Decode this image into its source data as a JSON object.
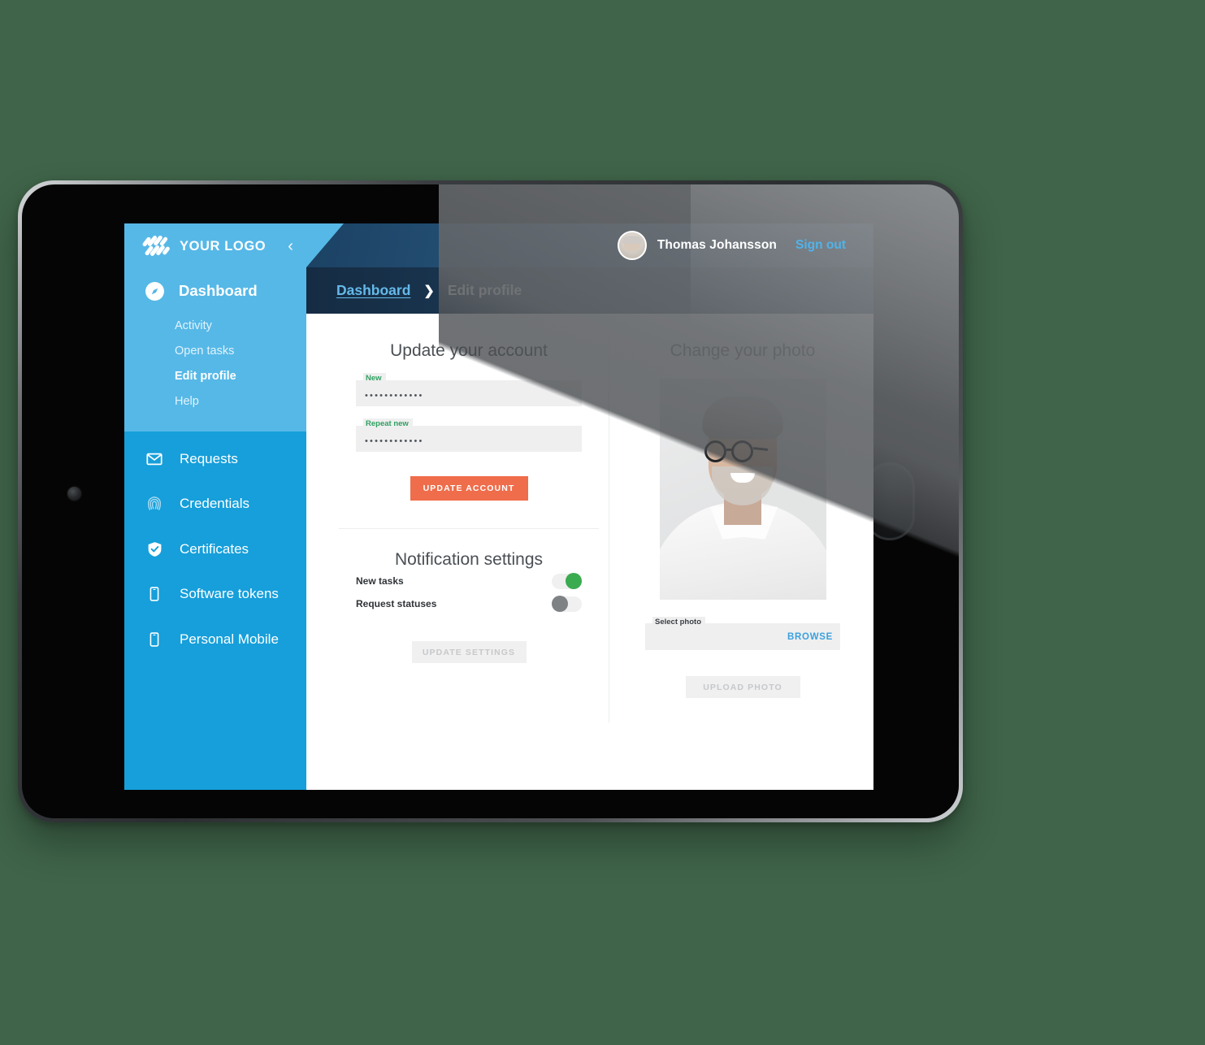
{
  "brand": {
    "logo_icon": "stacked-slashes-logo-icon",
    "name": "YOUR LOGO",
    "collapse_icon": "chevron-left-icon",
    "sidebar_color": "#169fda",
    "sidebar_active_color": "#56b8e7"
  },
  "sidebar": {
    "primary": {
      "label": "Dashboard",
      "icon": "compass-icon"
    },
    "sub_items": [
      {
        "label": "Activity",
        "active": false
      },
      {
        "label": "Open tasks",
        "active": false
      },
      {
        "label": "Edit profile",
        "active": true
      },
      {
        "label": "Help",
        "active": false
      }
    ],
    "items": [
      {
        "label": "Requests",
        "icon": "envelope-icon"
      },
      {
        "label": "Credentials",
        "icon": "fingerprint-icon"
      },
      {
        "label": "Certificates",
        "icon": "shield-check-icon"
      },
      {
        "label": "Software tokens",
        "icon": "mobile-phone-icon"
      },
      {
        "label": "Personal Mobile",
        "icon": "mobile-phone-icon"
      }
    ]
  },
  "header": {
    "user_name": "Thomas Johansson",
    "sign_out_label": "Sign out",
    "sign_out_color": "#4eb4ec",
    "avatar_icon": "user-avatar"
  },
  "breadcrumb": {
    "root": "Dashboard",
    "separator": "❯",
    "current": "Edit profile"
  },
  "account_section": {
    "title": "Update your account",
    "fields": [
      {
        "label": "New",
        "value": "••••••••••••",
        "placeholder": "New"
      },
      {
        "label": "Repeat new",
        "value": "••••••••••••",
        "placeholder": "Repeat new"
      }
    ],
    "submit_label": "UPDATE ACCOUNT",
    "submit_color": "#ef6d4b",
    "label_color": "#2fa05f"
  },
  "notification_section": {
    "title": "Notification settings",
    "toggles": [
      {
        "label": "New tasks",
        "state": "on",
        "on_color": "#3aab4f"
      },
      {
        "label": "Request statuses",
        "state": "off",
        "off_color": "#7e8285"
      }
    ],
    "submit_label": "UPDATE SETTINGS",
    "submit_disabled": true
  },
  "photo_section": {
    "title": "Change your photo",
    "preview_alt": "profile-photo-preview",
    "select_label": "Select photo",
    "select_value": "",
    "browse_label": "BROWSE",
    "browse_color": "#3ba1dd",
    "submit_label": "UPLOAD PHOTO",
    "submit_disabled": true
  },
  "device": {
    "type": "tablet",
    "home_button_icon": "home-button",
    "camera_icon": "front-camera-icon"
  }
}
